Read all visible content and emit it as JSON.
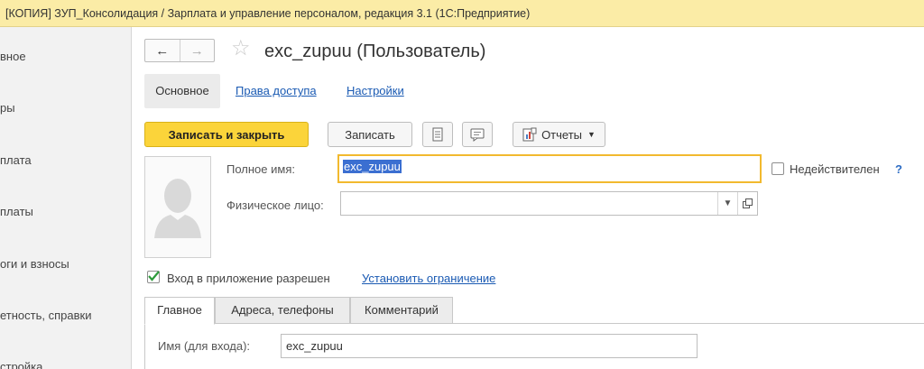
{
  "window": {
    "title": "[КОПИЯ] ЗУП_Консолидация / Зарплата и управление персоналом, редакция 3.1  (1С:Предприятие)"
  },
  "sidebar": {
    "items": [
      {
        "label": "вное"
      },
      {
        "label": "ры"
      },
      {
        "label": "плата"
      },
      {
        "label": "платы"
      },
      {
        "label": "оги и взносы"
      },
      {
        "label": "етность, справки"
      },
      {
        "label": "стройка"
      }
    ]
  },
  "form": {
    "title": "exc_zupuu (Пользователь)",
    "nav": {
      "back": "←",
      "forward": "→"
    },
    "tabs": [
      "Основное",
      "Права доступа",
      "Настройки"
    ],
    "toolbar": {
      "save_close": "Записать и закрыть",
      "save": "Записать",
      "reports": "Отчеты"
    },
    "full_name_label": "Полное имя:",
    "full_name_value": "exc_zupuu",
    "inactive_label": "Недействителен",
    "help": "?",
    "person_label": "Физическое лицо:",
    "person_value": "",
    "login_allowed": {
      "label": "Вход в приложение разрешен",
      "checked": true
    },
    "set_restriction": "Установить ограничение",
    "lower_tabs": [
      "Главное",
      "Адреса, телефоны",
      "Комментарий"
    ],
    "login_name_label": "Имя (для входа):",
    "login_name_value": "exc_zupuu"
  },
  "colors": {
    "accent": "#fbd43a",
    "link": "#1a5ab3",
    "titlebar": "#fbeca6",
    "focus": "#f2b92e",
    "check": "#2e9b3c"
  }
}
